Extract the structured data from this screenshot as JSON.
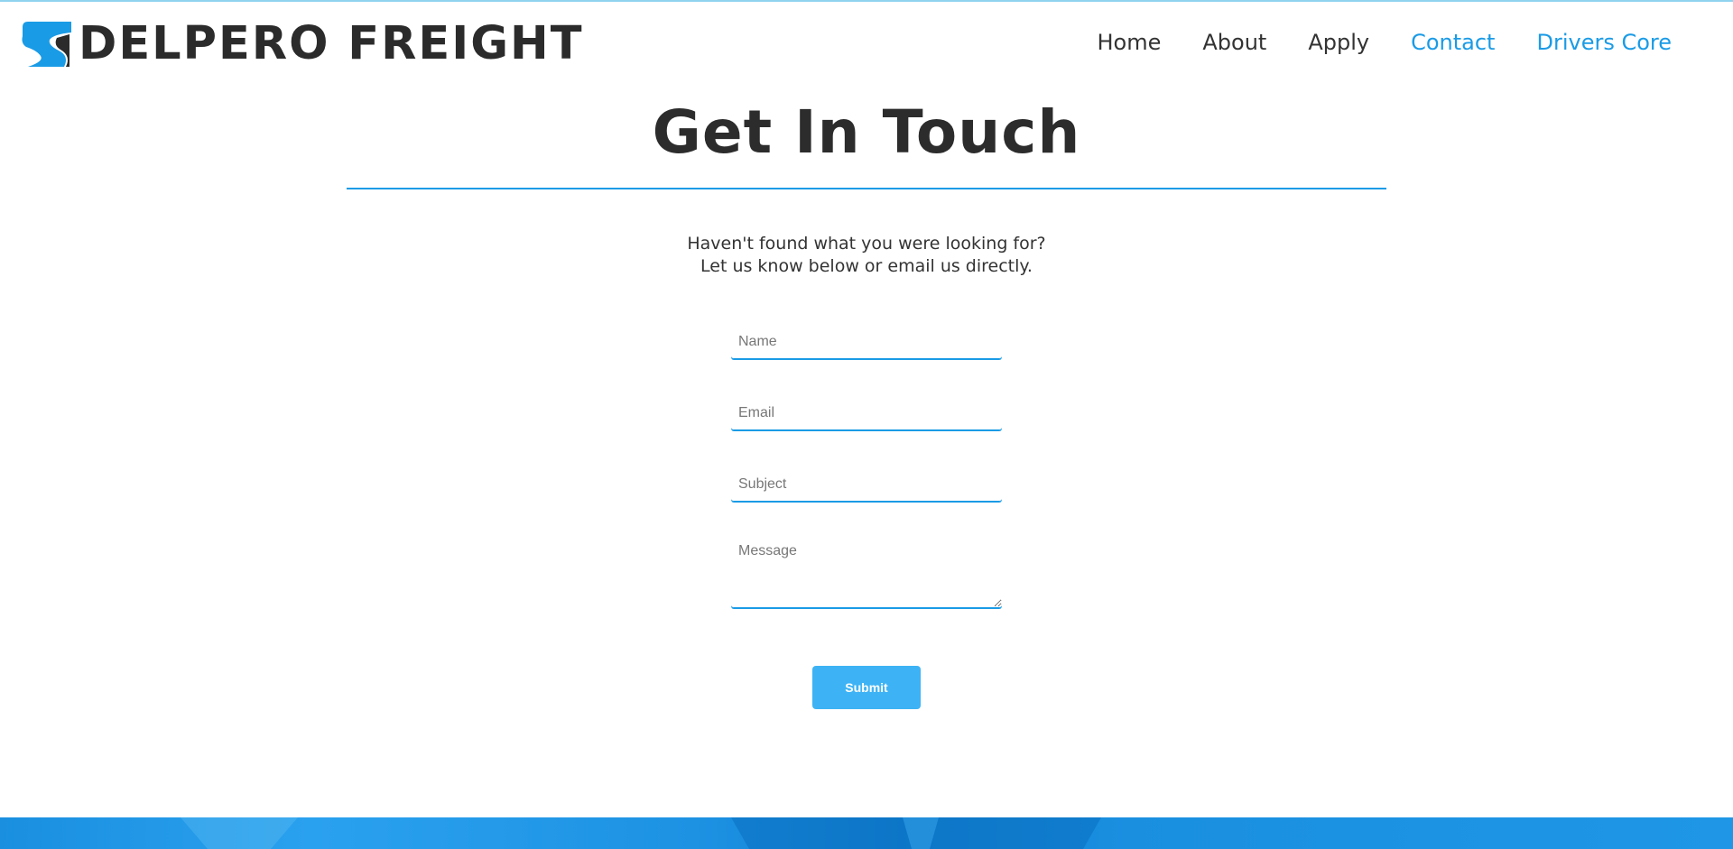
{
  "brand": {
    "name": "DELPERO FREIGHT",
    "logo_icon": "road-s-icon",
    "primary_color": "#1a9be6",
    "text_color": "#2b2b2b"
  },
  "nav": {
    "items": [
      {
        "label": "Home",
        "active": false
      },
      {
        "label": "About",
        "active": false
      },
      {
        "label": "Apply",
        "active": false
      },
      {
        "label": "Contact",
        "active": true
      },
      {
        "label": "Drivers Core",
        "active": true
      }
    ]
  },
  "main": {
    "title": "Get In Touch",
    "intro_line1": "Haven't found what you were looking for?",
    "intro_line2": "Let us know below or email us directly."
  },
  "form": {
    "name_placeholder": "Name",
    "email_placeholder": "Email",
    "subject_placeholder": "Subject",
    "message_placeholder": "Message",
    "submit_label": "Submit",
    "submit_color": "#3db3f5"
  }
}
